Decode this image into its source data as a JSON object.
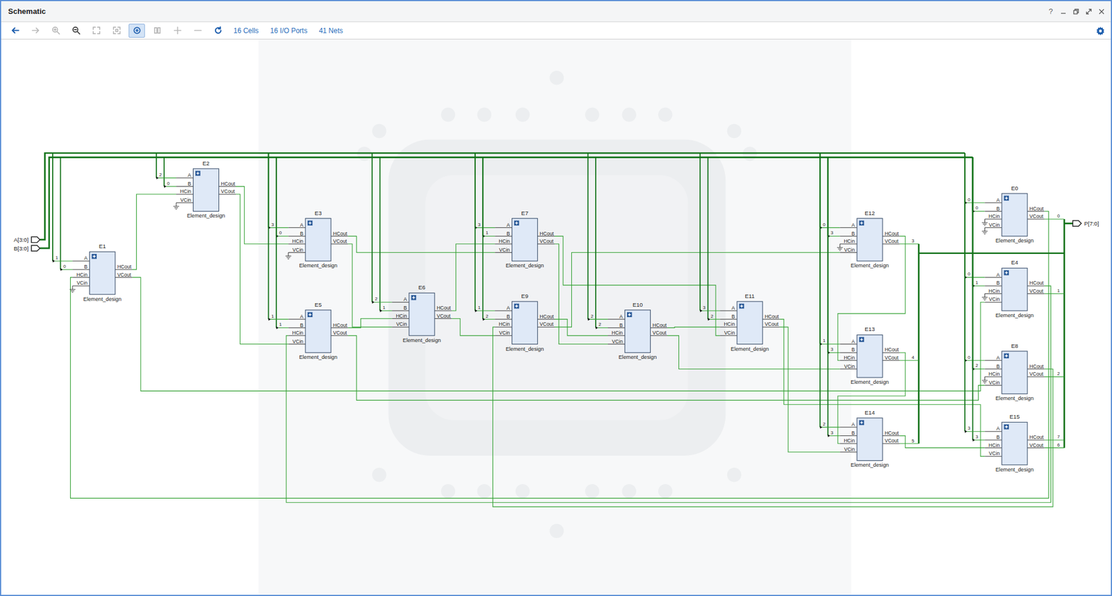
{
  "window": {
    "title": "Schematic",
    "help": "?"
  },
  "toolbar": {
    "tools": [
      {
        "kind": "back",
        "disabled": false,
        "pressed": false
      },
      {
        "kind": "forward",
        "disabled": true,
        "pressed": false
      },
      {
        "kind": "zoom-in",
        "disabled": true,
        "pressed": false
      },
      {
        "kind": "zoom-out",
        "disabled": false,
        "pressed": false
      },
      {
        "kind": "zoom-fit",
        "disabled": true,
        "pressed": false
      },
      {
        "kind": "zoom-selection",
        "disabled": true,
        "pressed": false
      },
      {
        "kind": "select",
        "disabled": false,
        "pressed": true
      },
      {
        "kind": "route",
        "disabled": true,
        "pressed": false
      },
      {
        "kind": "add",
        "disabled": true,
        "pressed": false
      },
      {
        "kind": "remove",
        "disabled": true,
        "pressed": false
      },
      {
        "kind": "refresh",
        "disabled": false,
        "pressed": false
      }
    ],
    "stats": [
      "16 Cells",
      "16 I/O Ports",
      "41 Nets"
    ]
  },
  "ports": {
    "inputs": [
      "A[3:0]",
      "B[3:0]"
    ],
    "outputs": [
      "P[7:0]"
    ]
  },
  "cells": [
    {
      "name": "E0",
      "type": "Element_design",
      "inputs": [
        "A",
        "B",
        "HCin",
        "VCin"
      ],
      "outputs": [
        "HCout",
        "VCout"
      ],
      "a_bit": "0",
      "b_bit": "0",
      "vcout_bit": "0"
    },
    {
      "name": "E1",
      "type": "Element_design",
      "inputs": [
        "A",
        "B",
        "HCin",
        "VCin"
      ],
      "outputs": [
        "HCout",
        "VCout"
      ],
      "a_bit": "1",
      "b_bit": "0"
    },
    {
      "name": "E2",
      "type": "Element_design",
      "inputs": [
        "A",
        "B",
        "HCin",
        "VCin"
      ],
      "outputs": [
        "HCout",
        "VCout"
      ],
      "a_bit": "2",
      "b_bit": "0"
    },
    {
      "name": "E3",
      "type": "Element_design",
      "inputs": [
        "A",
        "B",
        "HCin",
        "VCin"
      ],
      "outputs": [
        "HCout",
        "VCout"
      ],
      "a_bit": "3",
      "b_bit": "0"
    },
    {
      "name": "E4",
      "type": "Element_design",
      "inputs": [
        "A",
        "B",
        "HCin",
        "VCin"
      ],
      "outputs": [
        "HCout",
        "VCout"
      ],
      "a_bit": "0",
      "b_bit": "1",
      "vcout_bit": "1"
    },
    {
      "name": "E5",
      "type": "Element_design",
      "inputs": [
        "A",
        "B",
        "HCin",
        "VCin"
      ],
      "outputs": [
        "HCout",
        "VCout"
      ],
      "a_bit": "1",
      "b_bit": "1"
    },
    {
      "name": "E6",
      "type": "Element_design",
      "inputs": [
        "A",
        "B",
        "HCin",
        "VCin"
      ],
      "outputs": [
        "HCout",
        "VCout"
      ],
      "a_bit": "2",
      "b_bit": "1"
    },
    {
      "name": "E7",
      "type": "Element_design",
      "inputs": [
        "A",
        "B",
        "HCin",
        "VCin"
      ],
      "outputs": [
        "HCout",
        "VCout"
      ],
      "a_bit": "3",
      "b_bit": "1"
    },
    {
      "name": "E8",
      "type": "Element_design",
      "inputs": [
        "A",
        "B",
        "HCin",
        "VCin"
      ],
      "outputs": [
        "HCout",
        "VCout"
      ],
      "a_bit": "0",
      "b_bit": "2",
      "vcout_bit": "2"
    },
    {
      "name": "E9",
      "type": "Element_design",
      "inputs": [
        "A",
        "B",
        "HCin",
        "VCin"
      ],
      "outputs": [
        "HCout",
        "VCout"
      ],
      "a_bit": "1",
      "b_bit": "2"
    },
    {
      "name": "E10",
      "type": "Element_design",
      "inputs": [
        "A",
        "B",
        "HCin",
        "VCin"
      ],
      "outputs": [
        "HCout",
        "VCout"
      ],
      "a_bit": "2",
      "b_bit": "2"
    },
    {
      "name": "E11",
      "type": "Element_design",
      "inputs": [
        "A",
        "B",
        "HCin",
        "VCin"
      ],
      "outputs": [
        "HCout",
        "VCout"
      ],
      "a_bit": "3",
      "b_bit": "2"
    },
    {
      "name": "E12",
      "type": "Element_design",
      "inputs": [
        "A",
        "B",
        "HCin",
        "VCin"
      ],
      "outputs": [
        "HCout",
        "VCout"
      ],
      "a_bit": "0",
      "b_bit": "3",
      "vcout_bit": "3"
    },
    {
      "name": "E13",
      "type": "Element_design",
      "inputs": [
        "A",
        "B",
        "HCin",
        "VCin"
      ],
      "outputs": [
        "HCout",
        "VCout"
      ],
      "a_bit": "1",
      "b_bit": "3",
      "vcout_bit": "4"
    },
    {
      "name": "E14",
      "type": "Element_design",
      "inputs": [
        "A",
        "B",
        "HCin",
        "VCin"
      ],
      "outputs": [
        "HCout",
        "VCout"
      ],
      "a_bit": "2",
      "b_bit": "3",
      "vcout_bit": "5"
    },
    {
      "name": "E15",
      "type": "Element_design",
      "inputs": [
        "A",
        "B",
        "HCin",
        "VCin"
      ],
      "outputs": [
        "HCout",
        "VCout"
      ],
      "a_bit": "3",
      "b_bit": "3",
      "hcout_bit": "7",
      "vcout_bit": "6"
    }
  ]
}
